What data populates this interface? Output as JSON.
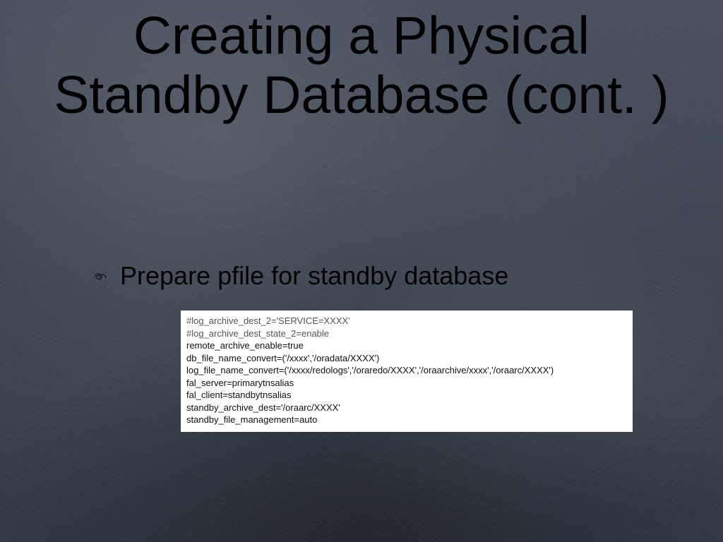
{
  "title_line1": "Creating a Physical",
  "title_line2": "Standby Database (cont. )",
  "bullet": {
    "text": "Prepare pfile for standby database"
  },
  "code": {
    "lines": [
      "#log_archive_dest_2='SERVICE=XXXX'",
      "#log_archive_dest_state_2=enable",
      "remote_archive_enable=true",
      "db_file_name_convert=('/xxxx','/oradata/XXXX')",
      "log_file_name_convert=('/xxxx/redologs','/oraredo/XXXX','/oraarchive/xxxx','/oraarc/XXXX')",
      "fal_server=primarytnsalias",
      "fal_client=standbytnsalias",
      "standby_archive_dest='/oraarc/XXXX'",
      "standby_file_management=auto"
    ]
  }
}
